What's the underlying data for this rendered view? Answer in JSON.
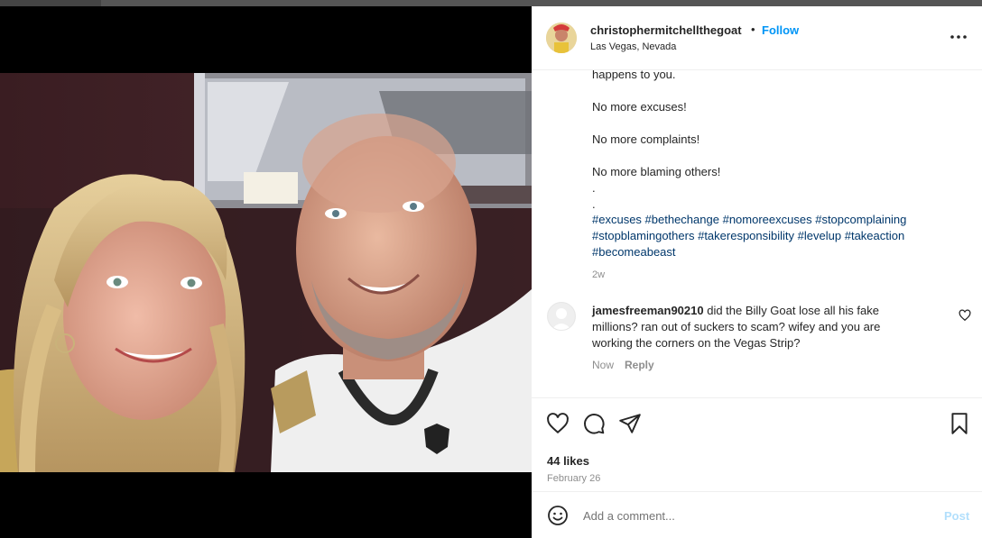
{
  "post": {
    "username": "christophermitchellthegoat",
    "separator": "•",
    "follow_label": "Follow",
    "location": "Las Vegas, Nevada",
    "more_icon": "more-options-icon"
  },
  "caption": {
    "lines": [
      "happens to you.",
      "No more excuses!",
      "No more complaints!",
      "No more blaming others!",
      ".",
      "."
    ],
    "hashtags": [
      "#excuses",
      "#bethechange",
      "#nomoreexcuses",
      "#stopcomplaining",
      "#stopblamingothers",
      "#takeresponsibility",
      "#levelup",
      "#takeaction",
      "#becomeabeast"
    ],
    "time_ago": "2w"
  },
  "comment": {
    "username": "jamesfreeman90210",
    "text": "did the Billy Goat lose all his fake millions? ran out of suckers to scam? wifey and you are working the corners on the Vegas Strip?",
    "time": "Now",
    "reply_label": "Reply"
  },
  "actions": {
    "likes": "44 likes",
    "date": "February 26"
  },
  "add_comment": {
    "placeholder": "Add a comment...",
    "post_label": "Post"
  },
  "colors": {
    "accent": "#0095f6",
    "hashtag": "#00376b",
    "muted": "#8e8e8e",
    "post_disabled": "#b2dffc"
  }
}
